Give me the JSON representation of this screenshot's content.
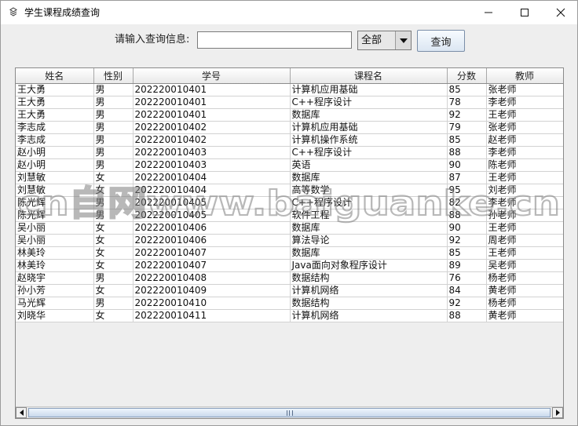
{
  "window": {
    "title": "学生课程成绩查询"
  },
  "search": {
    "label": "请输入查询信息:",
    "value": "",
    "placeholder": "",
    "filter_value": "全部",
    "button_label": "查询"
  },
  "table": {
    "columns": [
      "姓名",
      "性别",
      "学号",
      "课程名",
      "分数",
      "教师"
    ],
    "rows": [
      [
        "王大勇",
        "男",
        "202220010401",
        "计算机应用基础",
        "85",
        "张老师"
      ],
      [
        "王大勇",
        "男",
        "202220010401",
        "C++程序设计",
        "78",
        "李老师"
      ],
      [
        "王大勇",
        "男",
        "202220010401",
        "数据库",
        "92",
        "王老师"
      ],
      [
        "李志成",
        "男",
        "202220010402",
        "计算机应用基础",
        "79",
        "张老师"
      ],
      [
        "李志成",
        "男",
        "202220010402",
        "计算机操作系统",
        "85",
        "赵老师"
      ],
      [
        "赵小明",
        "男",
        "202220010403",
        "C++程序设计",
        "88",
        "李老师"
      ],
      [
        "赵小明",
        "男",
        "202220010403",
        "英语",
        "90",
        "陈老师"
      ],
      [
        "刘慧敏",
        "女",
        "202220010404",
        "数据库",
        "87",
        "王老师"
      ],
      [
        "刘慧敏",
        "女",
        "202220010404",
        "高等数学",
        "95",
        "刘老师"
      ],
      [
        "陈光辉",
        "男",
        "202220010405",
        "C++程序设计",
        "82",
        "李老师"
      ],
      [
        "陈光辉",
        "男",
        "202220010405",
        "软件工程",
        "88",
        "孙老师"
      ],
      [
        "吴小丽",
        "女",
        "202220010406",
        "数据库",
        "90",
        "王老师"
      ],
      [
        "吴小丽",
        "女",
        "202220010406",
        "算法导论",
        "92",
        "周老师"
      ],
      [
        "林美玲",
        "女",
        "202220010407",
        "数据库",
        "85",
        "王老师"
      ],
      [
        "林美玲",
        "女",
        "202220010407",
        "Java面向对象程序设计",
        "89",
        "吴老师"
      ],
      [
        "赵晓宇",
        "男",
        "202220010408",
        "数据结构",
        "76",
        "杨老师"
      ],
      [
        "孙小芳",
        "女",
        "202220010409",
        "计算机网络",
        "84",
        "黄老师"
      ],
      [
        "马光辉",
        "男",
        "202220010410",
        "数据结构",
        "92",
        "杨老师"
      ],
      [
        "刘晓华",
        "女",
        "202220010411",
        "计算机网络",
        "88",
        "黄老师"
      ]
    ]
  },
  "watermark": "cn自网www.baiguanke.cn",
  "icons": {
    "app": "app-icon",
    "minimize": "minimize-icon",
    "maximize": "maximize-icon",
    "close": "close-icon",
    "dropdown": "chevron-down-icon",
    "scroll_left": "scroll-left-icon",
    "scroll_right": "scroll-right-icon"
  }
}
